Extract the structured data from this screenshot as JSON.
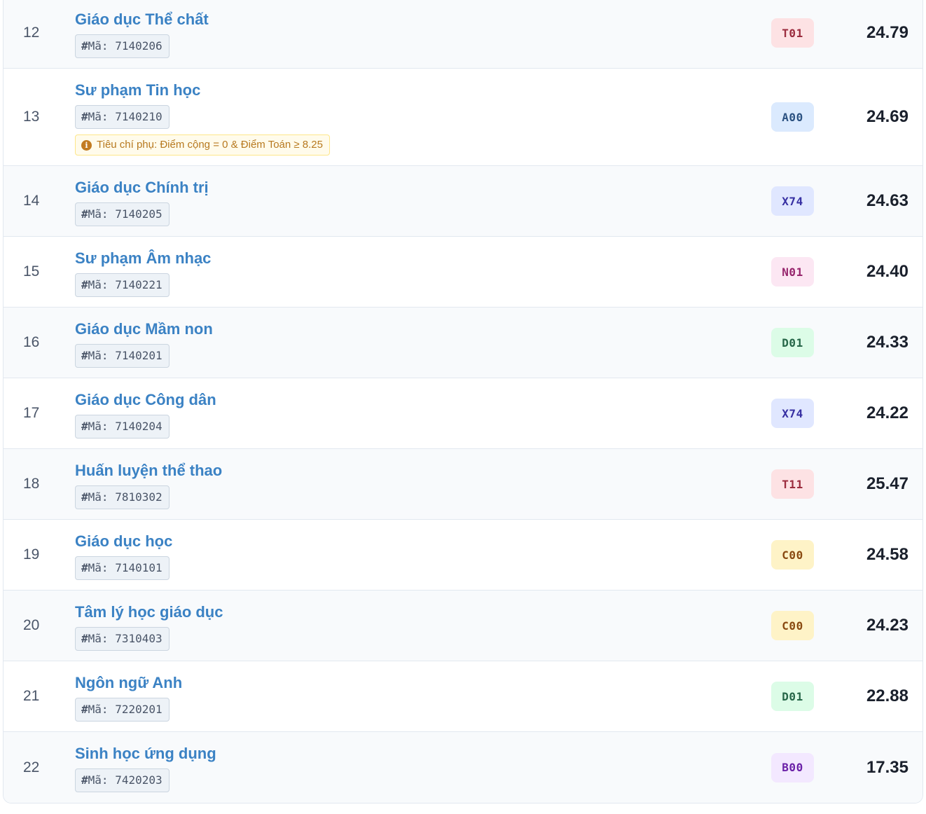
{
  "colors": {
    "T": {
      "bg": "#fde2e4",
      "fg": "#9b2c3e"
    },
    "A": {
      "bg": "#dbeafe",
      "fg": "#2c5282"
    },
    "X": {
      "bg": "#e0e7ff",
      "fg": "#3730a3"
    },
    "N": {
      "bg": "#fce7f3",
      "fg": "#97266d"
    },
    "D": {
      "bg": "#dcfce7",
      "fg": "#276749"
    },
    "C": {
      "bg": "#fef3c7",
      "fg": "#8a4b12"
    },
    "B": {
      "bg": "#f3e8ff",
      "fg": "#6b21a8"
    }
  },
  "code_prefix": "Mã:",
  "code_hash": "#",
  "rows": [
    {
      "stt": "12",
      "name": "Giáo dục Thể chất",
      "code": "7140206",
      "combo": "T01",
      "score": "24.79"
    },
    {
      "stt": "13",
      "name": "Sư phạm Tin học",
      "code": "7140210",
      "combo": "A00",
      "score": "24.69",
      "note": "Tiêu chí phụ: Điểm cộng = 0 & Điểm Toán ≥ 8.25"
    },
    {
      "stt": "14",
      "name": "Giáo dục Chính trị",
      "code": "7140205",
      "combo": "X74",
      "score": "24.63"
    },
    {
      "stt": "15",
      "name": "Sư phạm Âm nhạc",
      "code": "7140221",
      "combo": "N01",
      "score": "24.40"
    },
    {
      "stt": "16",
      "name": "Giáo dục Mầm non",
      "code": "7140201",
      "combo": "D01",
      "score": "24.33"
    },
    {
      "stt": "17",
      "name": "Giáo dục Công dân",
      "code": "7140204",
      "combo": "X74",
      "score": "24.22"
    },
    {
      "stt": "18",
      "name": "Huấn luyện thể thao",
      "code": "7810302",
      "combo": "T11",
      "score": "25.47"
    },
    {
      "stt": "19",
      "name": "Giáo dục học",
      "code": "7140101",
      "combo": "C00",
      "score": "24.58"
    },
    {
      "stt": "20",
      "name": "Tâm lý học giáo dục",
      "code": "7310403",
      "combo": "C00",
      "score": "24.23"
    },
    {
      "stt": "21",
      "name": "Ngôn ngữ Anh",
      "code": "7220201",
      "combo": "D01",
      "score": "22.88"
    },
    {
      "stt": "22",
      "name": "Sinh học ứng dụng",
      "code": "7420203",
      "combo": "B00",
      "score": "17.35"
    }
  ]
}
